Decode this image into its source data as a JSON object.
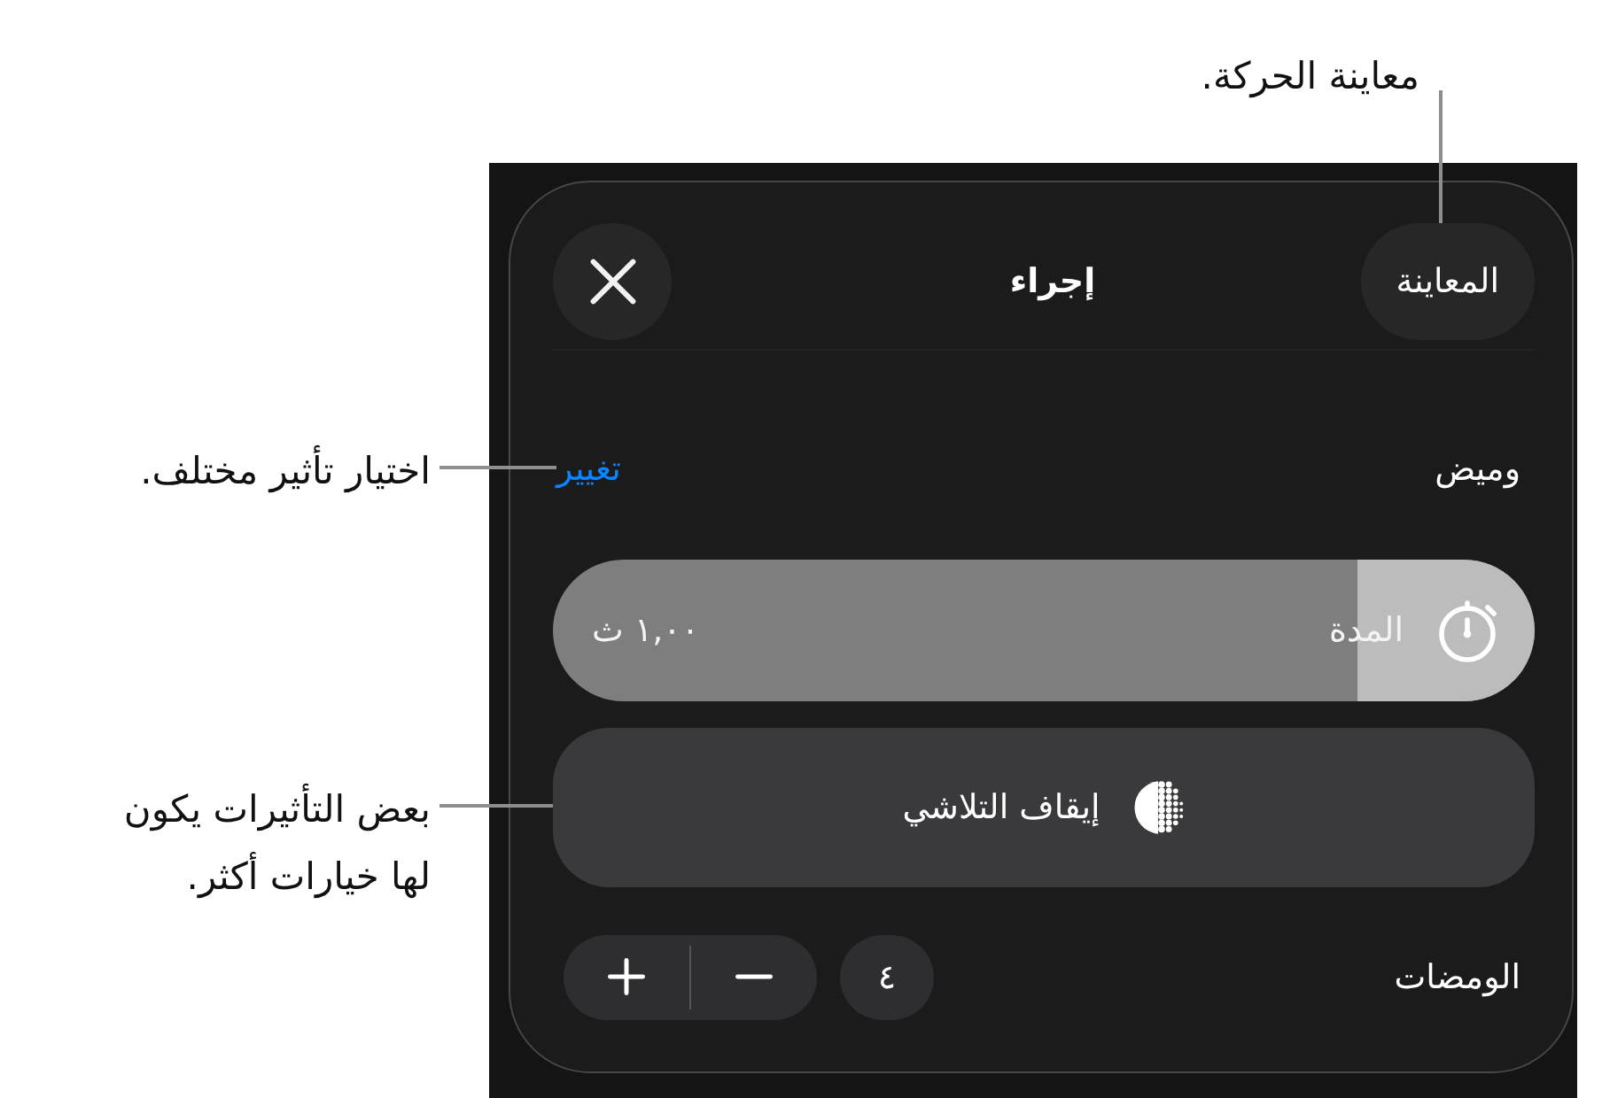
{
  "action_panel": {
    "header": {
      "preview_button": {
        "label": "المعاينة",
        "callout": {
          "kind": "top",
          "text": "معاينة الحركة."
        }
      },
      "title": "إجراء"
    },
    "effect_row": {
      "label": "وميض",
      "change_link": {
        "label": "تغيير",
        "callout": {
          "kind": "left",
          "text": "اختيار تأثير مختلف."
        }
      }
    },
    "duration_slider": {
      "label": "المدة",
      "reading": "١,٠٠ ث",
      "level": 0.18
    },
    "option_button": {
      "label": "إيقاف التلاشي",
      "callout": {
        "kind": "left",
        "text": "بعض التأثيرات يكون\nلها خيارات أكثر."
      }
    },
    "flashes_row": {
      "label": "الومضات",
      "value": "٤"
    }
  }
}
